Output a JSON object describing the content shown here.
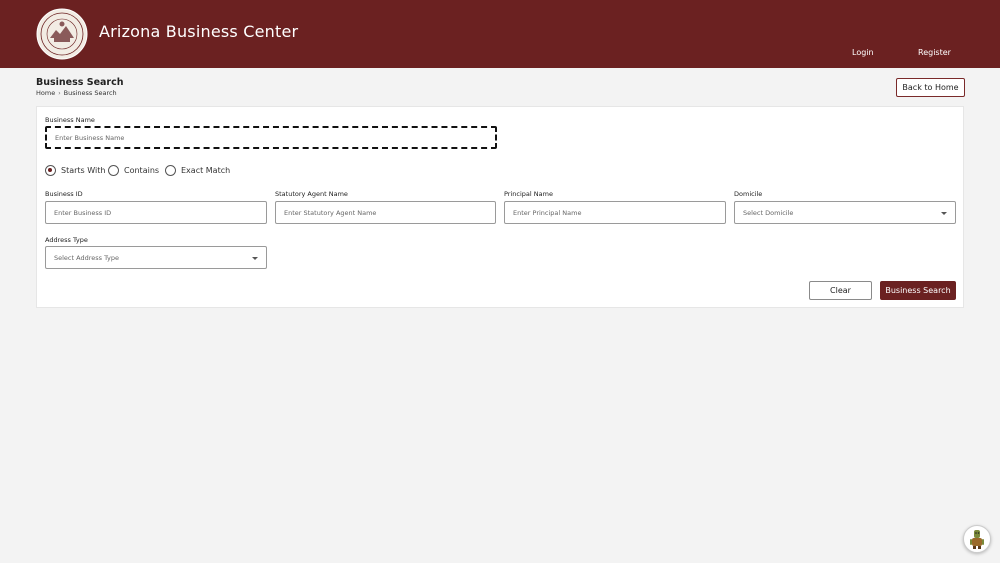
{
  "header": {
    "title": "Arizona Business Center",
    "nav": {
      "login": "Login",
      "register": "Register"
    }
  },
  "page": {
    "title": "Business Search",
    "breadcrumb": [
      "Home",
      "Business Search"
    ],
    "back_button": "Back to Home"
  },
  "form": {
    "business_name": {
      "label": "Business Name",
      "placeholder": "Enter Business Name"
    },
    "match_options": [
      {
        "label": "Starts With",
        "checked": true
      },
      {
        "label": "Contains",
        "checked": false
      },
      {
        "label": "Exact Match",
        "checked": false
      }
    ],
    "business_id": {
      "label": "Business ID",
      "placeholder": "Enter Business ID"
    },
    "agent_name": {
      "label": "Statutory Agent Name",
      "placeholder": "Enter Statutory Agent Name"
    },
    "principal_name": {
      "label": "Principal Name",
      "placeholder": "Enter Principal Name"
    },
    "domicile": {
      "label": "Domicile",
      "selected": "Select Domicile"
    },
    "address_type": {
      "label": "Address Type",
      "selected": "Select Address Type"
    },
    "clear_button": "Clear",
    "search_button": "Business Search"
  },
  "colors": {
    "brand": "#6b2121",
    "background": "#f3f3f3"
  },
  "icons": {
    "seal": "state-seal-icon",
    "help": "help-bot-icon",
    "dropdown": "chevron-down-icon"
  }
}
